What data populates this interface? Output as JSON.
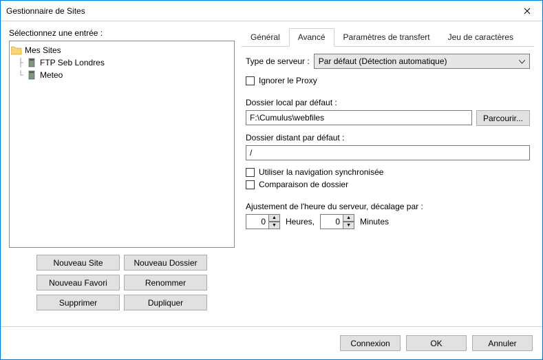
{
  "window": {
    "title": "Gestionnaire de Sites"
  },
  "left": {
    "label": "Sélectionnez une entrée :",
    "tree": {
      "root": "Mes Sites",
      "items": [
        {
          "label": "FTP Seb Londres"
        },
        {
          "label": "Meteo"
        }
      ]
    },
    "buttons": {
      "new_site": "Nouveau Site",
      "new_folder": "Nouveau Dossier",
      "new_bookmark": "Nouveau Favori",
      "rename": "Renommer",
      "delete": "Supprimer",
      "duplicate": "Dupliquer"
    }
  },
  "tabs": {
    "general": "Général",
    "advanced": "Avancé",
    "transfer": "Paramètres de transfert",
    "charset": "Jeu de caractères"
  },
  "advanced": {
    "server_type_label": "Type de serveur :",
    "server_type_value": "Par défaut (Détection automatique)",
    "ignore_proxy": "Ignorer le Proxy",
    "local_dir_label": "Dossier local par défaut :",
    "local_dir_value": "F:\\Cumulus\\webfiles",
    "browse": "Parcourir...",
    "remote_dir_label": "Dossier distant par défaut :",
    "remote_dir_value": "/",
    "sync_browsing": "Utiliser la navigation synchronisée",
    "dir_compare": "Comparaison de dossier",
    "time_offset_label": "Ajustement de l'heure du serveur, décalage par :",
    "hours_value": "0",
    "hours_label": "Heures,",
    "minutes_value": "0",
    "minutes_label": "Minutes"
  },
  "footer": {
    "connect": "Connexion",
    "ok": "OK",
    "cancel": "Annuler"
  }
}
